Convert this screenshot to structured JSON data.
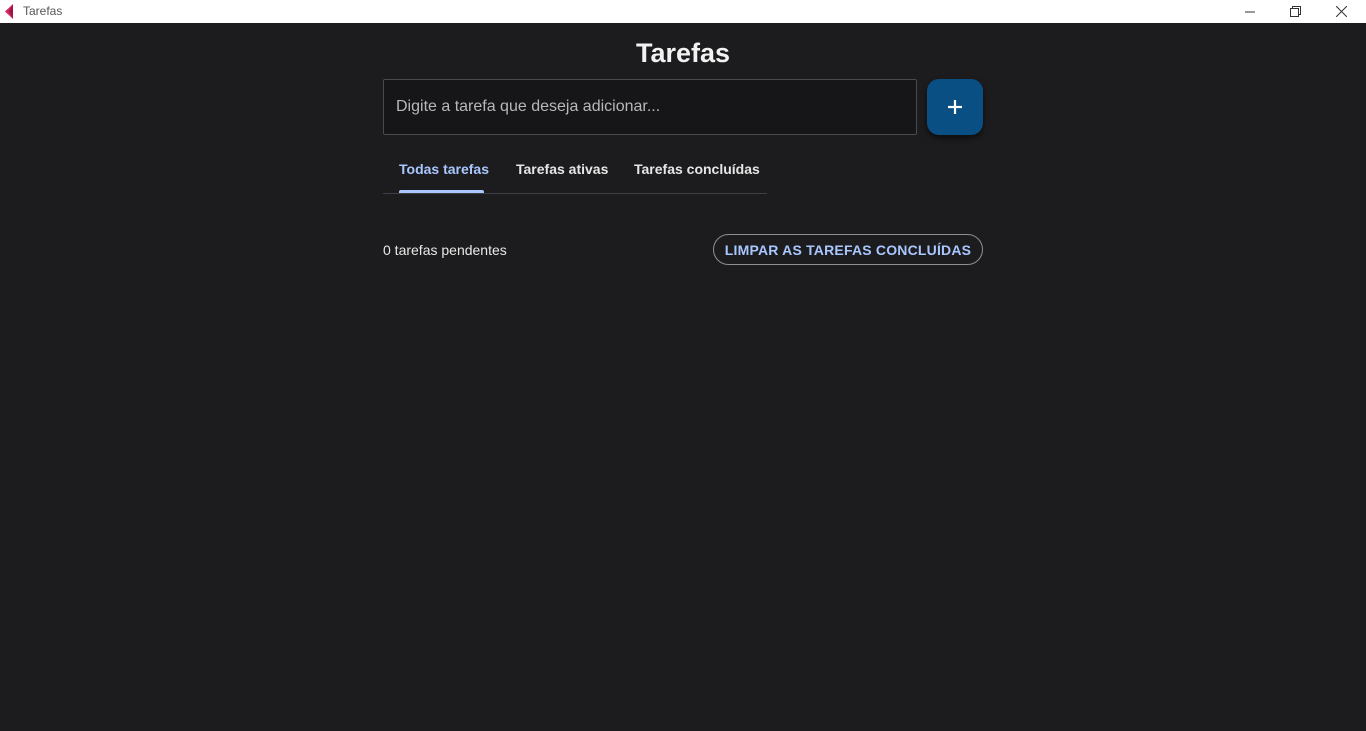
{
  "window": {
    "title": "Tarefas"
  },
  "header": {
    "title": "Tarefas"
  },
  "input": {
    "placeholder": "Digite a tarefa que deseja adicionar...",
    "value": ""
  },
  "add_button": {
    "icon": "plus-icon",
    "color": "#0a4f84"
  },
  "tabs": [
    {
      "label": "Todas tarefas",
      "active": true
    },
    {
      "label": "Tarefas ativas",
      "active": false
    },
    {
      "label": "Tarefas concluídas",
      "active": false
    }
  ],
  "footer": {
    "pending_text": "0 tarefas pendentes",
    "clear_label": "LIMPAR AS TAREFAS CONCLUÍDAS"
  },
  "colors": {
    "background": "#1c1c1e",
    "accent": "#a9c7ff",
    "button": "#0a4f84"
  }
}
